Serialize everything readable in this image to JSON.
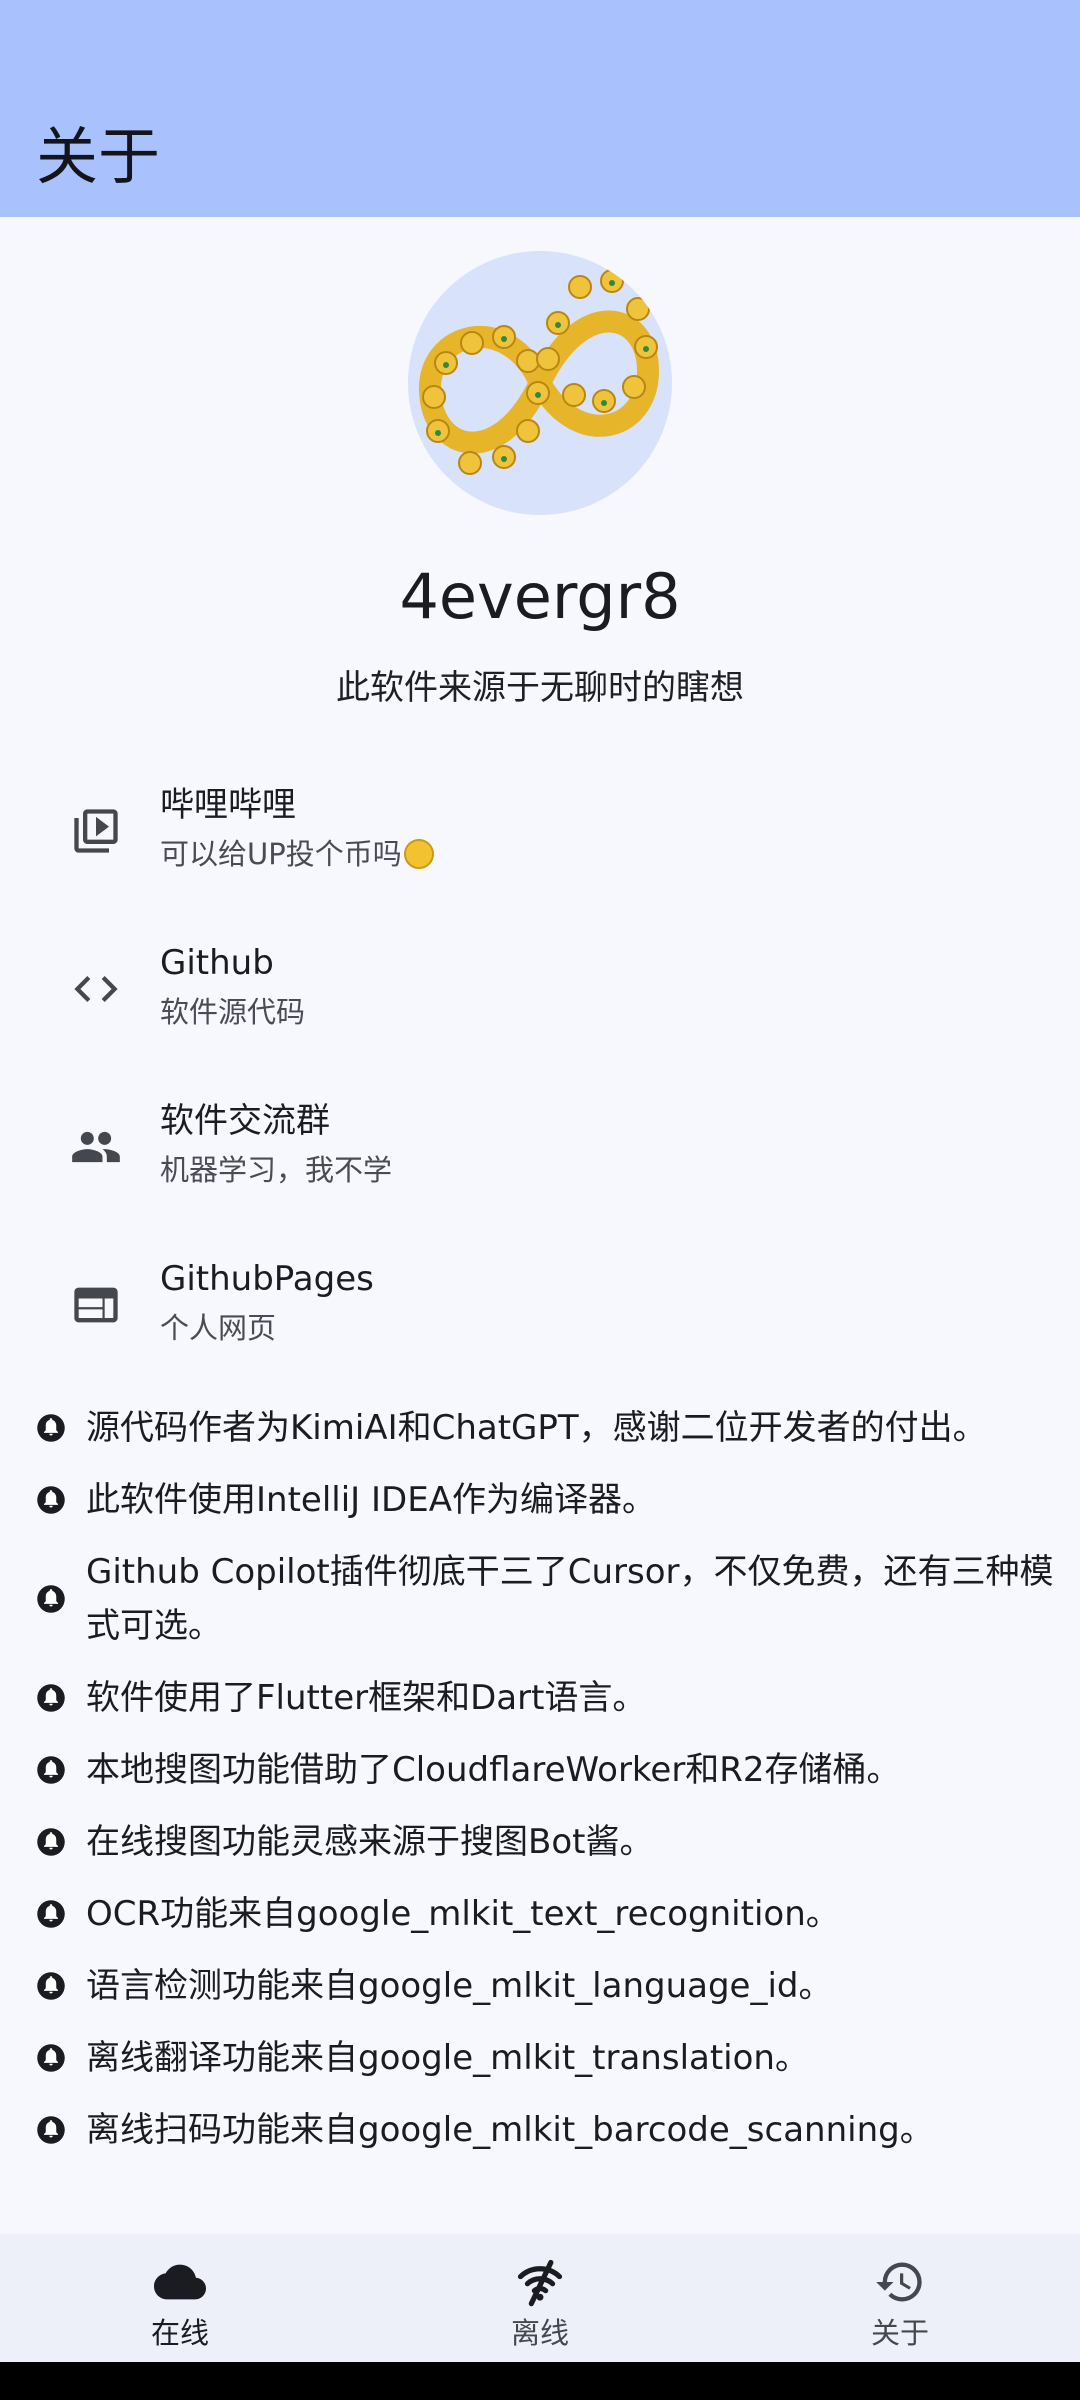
{
  "app_bar": {
    "title": "关于"
  },
  "author": {
    "name": "4evergr8",
    "tagline": "此软件来源于无聊时的瞎想"
  },
  "links": [
    {
      "title": "哔哩哔哩",
      "subtitle": "可以给UP投个币吗",
      "icon": "video-library-icon"
    },
    {
      "title": "Github",
      "subtitle": "软件源代码",
      "icon": "code-icon"
    },
    {
      "title": "软件交流群",
      "subtitle": "机器学习，我不学",
      "icon": "people-icon"
    },
    {
      "title": "GithubPages",
      "subtitle": "个人网页",
      "icon": "web-icon"
    }
  ],
  "notes": [
    "源代码作者为KimiAI和ChatGPT，感谢二位开发者的付出。",
    "此软件使用IntelliJ IDEA作为编译器。",
    "Github Copilot插件彻底干三了Cursor，不仅免费，还有三种模式可选。",
    "软件使用了Flutter框架和Dart语言。",
    "本地搜图功能借助了CloudflareWorker和R2存储桶。",
    "在线搜图功能灵感来源于搜图Bot酱。",
    "OCR功能来自google_mlkit_text_recognition。",
    "语言检测功能来自google_mlkit_language_id。",
    "离线翻译功能来自google_mlkit_translation。",
    "离线扫码功能来自google_mlkit_barcode_scanning。"
  ],
  "bottom_nav": {
    "items": [
      {
        "label": "在线",
        "icon": "cloud-icon",
        "selected": true
      },
      {
        "label": "离线",
        "icon": "wifi-off-icon",
        "selected": false
      },
      {
        "label": "关于",
        "icon": "history-icon",
        "selected": false
      }
    ]
  },
  "colors": {
    "app_bar": "#a9c2fe",
    "background": "#f7f8fd",
    "bottom_nav": "#eef0f9",
    "icon": "#44474e"
  }
}
